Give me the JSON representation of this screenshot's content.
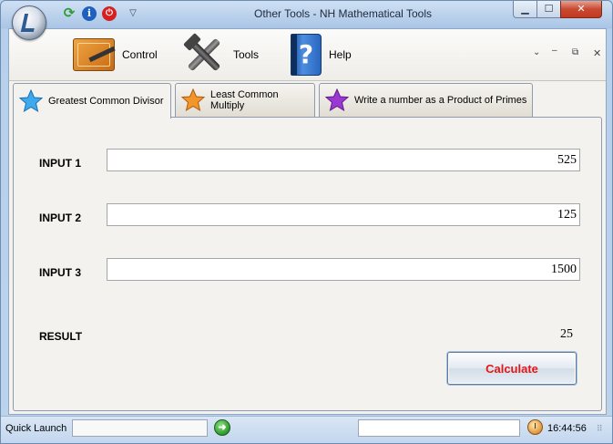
{
  "window": {
    "title": "Other Tools - NH Mathematical Tools",
    "minimize_glyph": "▁",
    "maximize_glyph": "☐",
    "close_glyph": "✕"
  },
  "quick_access": {
    "refresh_glyph": "⟳",
    "info_glyph": "i",
    "power_glyph": "⏻",
    "dropdown_glyph": "▽"
  },
  "ribbon": {
    "buttons": [
      {
        "label": "Control",
        "icon": "control-panel-icon"
      },
      {
        "label": "Tools",
        "icon": "hammer-wrench-icon"
      },
      {
        "label": "Help",
        "icon": "help-book-icon"
      }
    ],
    "icon_help_glyph": "?",
    "chevron_glyph": "⌄",
    "minimize_glyph": "–",
    "restore_glyph": "⧉",
    "close_glyph": "✕"
  },
  "tabs": [
    {
      "label": "Greatest Common Divisor",
      "star_color": "#3fa9ee",
      "active": true
    },
    {
      "label": "Least Common Multiply",
      "star_color": "#f2952b",
      "active": false
    },
    {
      "label": "Write a number as a Product of Primes",
      "star_color": "#9b38d2",
      "active": false
    }
  ],
  "form": {
    "input1": {
      "label": "INPUT 1",
      "value": "525"
    },
    "input2": {
      "label": "INPUT 2",
      "value": "125"
    },
    "input3": {
      "label": "INPUT 3",
      "value": "1500"
    },
    "result": {
      "label": "RESULT",
      "value": "25"
    },
    "calculate_label": "Calculate"
  },
  "statusbar": {
    "quick_launch_label": "Quick Launch",
    "quick_launch_value": "",
    "go_glyph": "➜",
    "status_text": "",
    "time": "16:44:56",
    "grip_glyph": "⠿"
  },
  "colors": {
    "calculate_text": "#e01818",
    "accent_border": "#5f7ca3"
  }
}
